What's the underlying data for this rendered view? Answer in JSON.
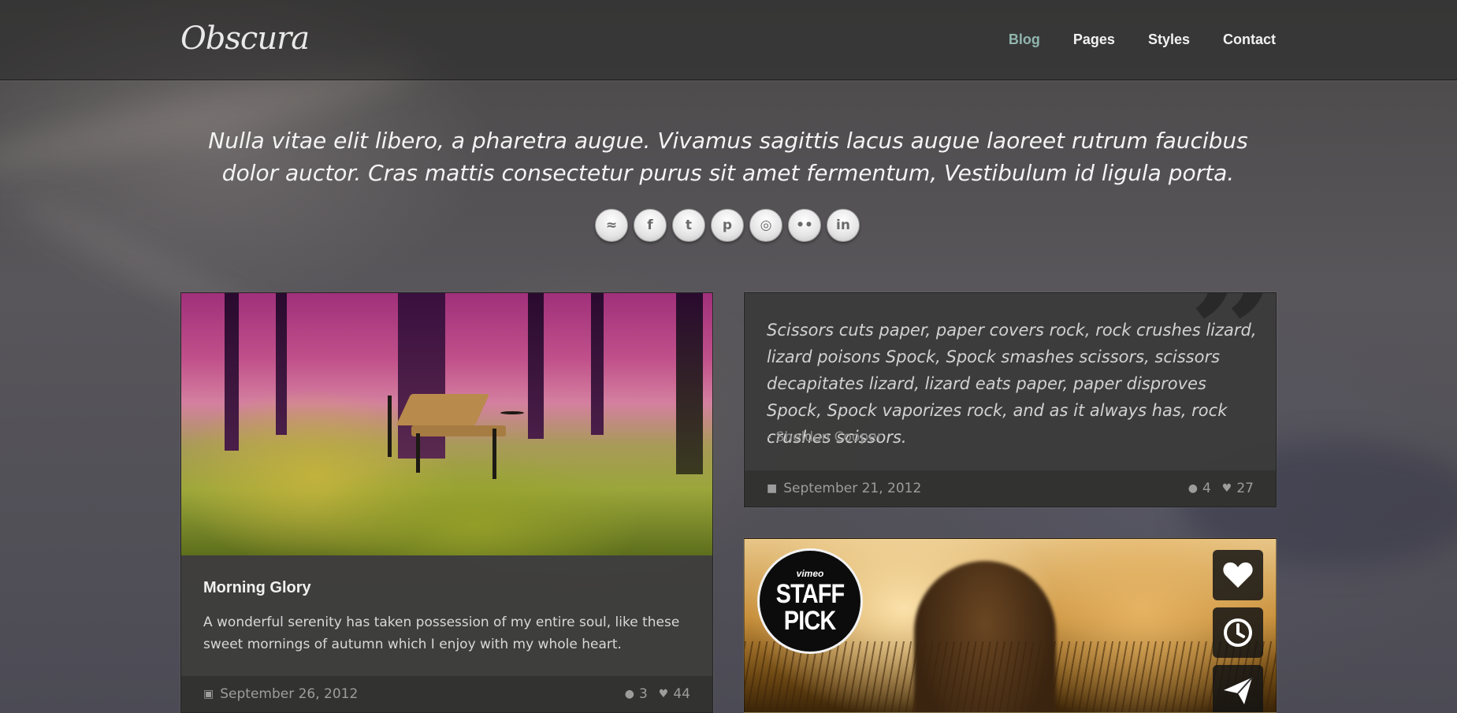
{
  "brand": {
    "logo": "Obscura"
  },
  "nav": [
    {
      "label": "Blog",
      "active": true
    },
    {
      "label": "Pages",
      "active": false
    },
    {
      "label": "Styles",
      "active": false
    },
    {
      "label": "Contact",
      "active": false
    }
  ],
  "tagline": "Nulla vitae elit libero, a pharetra augue. Vivamus sagittis lacus augue laoreet rutrum faucibus dolor auctor. Cras mattis consectetur purus sit amet fermentum, Vestibulum id ligula porta.",
  "socials": [
    {
      "icon": "rss-icon",
      "glyph": "≈"
    },
    {
      "icon": "facebook-icon",
      "glyph": "f"
    },
    {
      "icon": "twitter-icon",
      "glyph": "t"
    },
    {
      "icon": "pinterest-icon",
      "glyph": "p"
    },
    {
      "icon": "dribbble-icon",
      "glyph": "◎"
    },
    {
      "icon": "flickr-icon",
      "glyph": "••"
    },
    {
      "icon": "linkedin-icon",
      "glyph": "in"
    }
  ],
  "posts": {
    "morning": {
      "title": "Morning Glory",
      "excerpt": "A wonderful serenity has taken possession of my entire soul, like these sweet mornings of autumn which I enjoy with my whole heart.",
      "date": "September 26, 2012",
      "comments": "3",
      "likes": "44",
      "type_icon": "image-icon"
    },
    "quote": {
      "text": "Scissors cuts paper, paper covers rock, rock crushes lizard, lizard poisons Spock, Spock smashes scissors, scissors decapitates lizard, lizard eats paper, paper disproves Spock, Spock vaporizes rock, and as it always has, rock crushes scissors.",
      "author": "- Sheldon Cooper",
      "date": "September 21, 2012",
      "comments": "4",
      "likes": "27",
      "type_icon": "comment-icon"
    },
    "video": {
      "badge_top": "vimeo",
      "badge_line1": "STAFF",
      "badge_line2": "PICK"
    }
  },
  "colors": {
    "nav_active": "#8fb6ad",
    "meta_text": "#9d9d9d"
  }
}
